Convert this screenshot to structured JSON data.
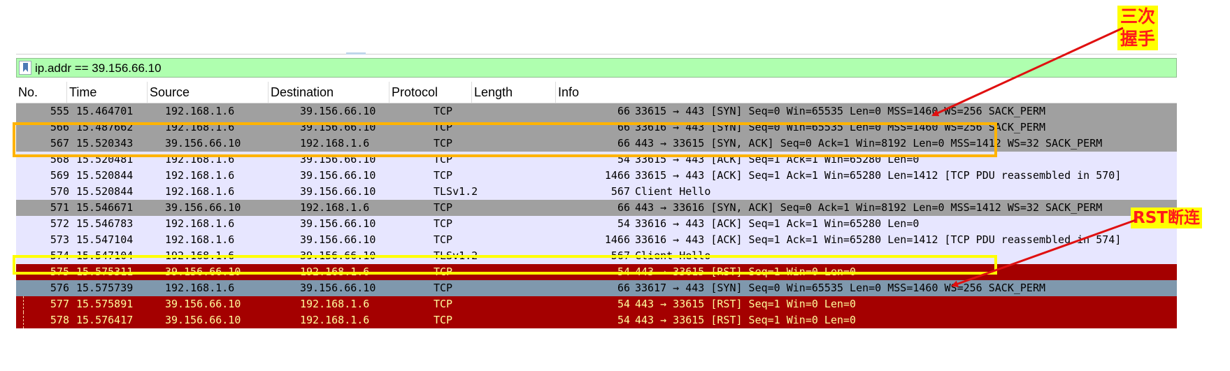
{
  "filter": {
    "value": "ip.addr == 39.156.66.10"
  },
  "columns": [
    "No.",
    "Time",
    "Source",
    "Destination",
    "Protocol",
    "Length",
    "Info"
  ],
  "rows": [
    {
      "no": "555",
      "time": "15.464701",
      "src": "192.168.1.6",
      "dst": "39.156.66.10",
      "proto": "TCP",
      "len": "66",
      "info": "33615 → 443 [SYN] Seq=0 Win=65535 Len=0 MSS=1460 WS=256 SACK_PERM",
      "style": "gray"
    },
    {
      "no": "566",
      "time": "15.487662",
      "src": "192.168.1.6",
      "dst": "39.156.66.10",
      "proto": "TCP",
      "len": "66",
      "info": "33616 → 443 [SYN] Seq=0 Win=65535 Len=0 MSS=1460 WS=256 SACK_PERM",
      "style": "gray"
    },
    {
      "no": "567",
      "time": "15.520343",
      "src": "39.156.66.10",
      "dst": "192.168.1.6",
      "proto": "TCP",
      "len": "66",
      "info": "443 → 33615 [SYN, ACK] Seq=0 Ack=1 Win=8192 Len=0 MSS=1412 WS=32 SACK_PERM",
      "style": "gray"
    },
    {
      "no": "568",
      "time": "15.520481",
      "src": "192.168.1.6",
      "dst": "39.156.66.10",
      "proto": "TCP",
      "len": "54",
      "info": "33615 → 443 [ACK] Seq=1 Ack=1 Win=65280 Len=0",
      "style": "lav"
    },
    {
      "no": "569",
      "time": "15.520844",
      "src": "192.168.1.6",
      "dst": "39.156.66.10",
      "proto": "TCP",
      "len": "1466",
      "info": "33615 → 443 [ACK] Seq=1 Ack=1 Win=65280 Len=1412 [TCP PDU reassembled in 570]",
      "style": "lav"
    },
    {
      "no": "570",
      "time": "15.520844",
      "src": "192.168.1.6",
      "dst": "39.156.66.10",
      "proto": "TLSv1.2",
      "len": "567",
      "info": "Client Hello",
      "style": "lav"
    },
    {
      "no": "571",
      "time": "15.546671",
      "src": "39.156.66.10",
      "dst": "192.168.1.6",
      "proto": "TCP",
      "len": "66",
      "info": "443 → 33616 [SYN, ACK] Seq=0 Ack=1 Win=8192 Len=0 MSS=1412 WS=32 SACK_PERM",
      "style": "gray"
    },
    {
      "no": "572",
      "time": "15.546783",
      "src": "192.168.1.6",
      "dst": "39.156.66.10",
      "proto": "TCP",
      "len": "54",
      "info": "33616 → 443 [ACK] Seq=1 Ack=1 Win=65280 Len=0",
      "style": "lav"
    },
    {
      "no": "573",
      "time": "15.547104",
      "src": "192.168.1.6",
      "dst": "39.156.66.10",
      "proto": "TCP",
      "len": "1466",
      "info": "33616 → 443 [ACK] Seq=1 Ack=1 Win=65280 Len=1412 [TCP PDU reassembled in 574]",
      "style": "lav"
    },
    {
      "no": "574",
      "time": "15.547104",
      "src": "192.168.1.6",
      "dst": "39.156.66.10",
      "proto": "TLSv1.2",
      "len": "567",
      "info": "Client Hello",
      "style": "lav"
    },
    {
      "no": "575",
      "time": "15.575311",
      "src": "39.156.66.10",
      "dst": "192.168.1.6",
      "proto": "TCP",
      "len": "54",
      "info": "443 → 33615 [RST] Seq=1 Win=0 Len=0",
      "style": "red"
    },
    {
      "no": "576",
      "time": "15.575739",
      "src": "192.168.1.6",
      "dst": "39.156.66.10",
      "proto": "TCP",
      "len": "66",
      "info": "33617 → 443 [SYN] Seq=0 Win=65535 Len=0 MSS=1460 WS=256 SACK_PERM",
      "style": "blue"
    },
    {
      "no": "577",
      "time": "15.575891",
      "src": "39.156.66.10",
      "dst": "192.168.1.6",
      "proto": "TCP",
      "len": "54",
      "info": "443 → 33615 [RST] Seq=1 Win=0 Len=0",
      "style": "red"
    },
    {
      "no": "578",
      "time": "15.576417",
      "src": "39.156.66.10",
      "dst": "192.168.1.6",
      "proto": "TCP",
      "len": "54",
      "info": "443 → 33615 [RST] Seq=1 Win=0 Len=0",
      "style": "red"
    }
  ],
  "row_styles": {
    "gray": "#a0a0a0",
    "lav": "#e7e6ff",
    "red": "#a40000",
    "blue": "#7f98ad"
  },
  "annotations": {
    "handshake": {
      "line1": "三次",
      "line2": "握手",
      "color": "#ff1a1a",
      "background": "#ffff00"
    },
    "rst": {
      "label": "RST断连",
      "color": "#ff1a1a",
      "background": "#ffff00"
    },
    "handshake_box_color": "#ffb300",
    "rst_box_color": "#ffff00"
  }
}
